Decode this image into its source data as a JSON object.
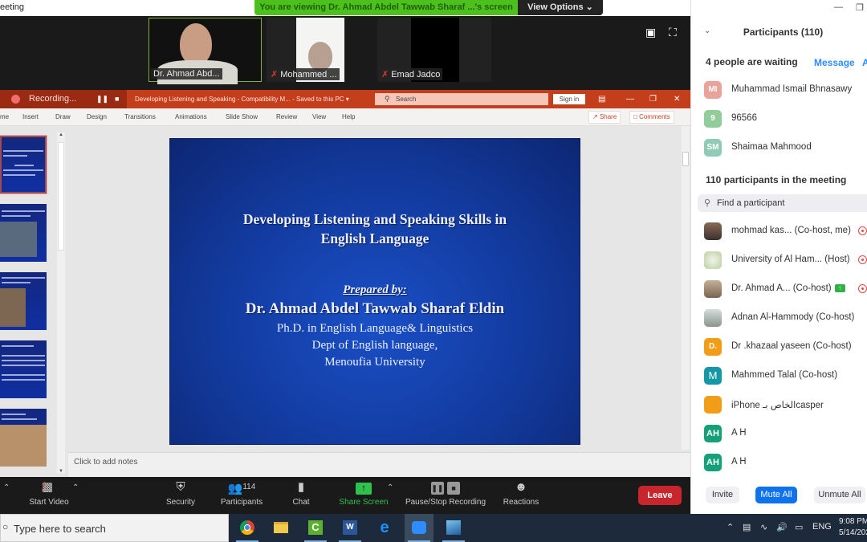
{
  "window": {
    "title": "eeting",
    "viewing_banner": "You are viewing Dr. Ahmad Abdel Tawwab Sharaf ...'s screen",
    "view_options": "View Options",
    "view_options_icon": "chevron-down-icon"
  },
  "video_tiles": [
    {
      "name": "Dr. Ahmad Abd...",
      "muted": false,
      "active_speaker": true
    },
    {
      "name": "Mohammed ...",
      "muted": true
    },
    {
      "name": "Emad Jadco",
      "muted": true
    }
  ],
  "video_controls": {
    "layout_icon": "speaker-view-icon",
    "fullscreen_icon": "fullscreen-icon"
  },
  "powerpoint": {
    "recording_label": "Recording...",
    "doc_title": "Developing Listening and Speaking  -  Compatibility M...   -  Saved to this PC  ▾",
    "search_placeholder": "Search",
    "sign_in": "Sign in",
    "ribbon_tabs": [
      "me",
      "Insert",
      "Draw",
      "Design",
      "Transitions",
      "Animations",
      "Slide Show",
      "Review",
      "View",
      "Help"
    ],
    "share": "Share",
    "comments": "Comments",
    "notes_placeholder": "Click to add notes",
    "slide": {
      "title_line1": "Developing Listening and Speaking Skills in",
      "title_line2": "English Language",
      "prepared_by": "Prepared by:",
      "author": "Dr. Ahmad Abdel Tawwab Sharaf Eldin",
      "degree": "Ph.D. in English Language& Linguistics",
      "dept": "Dept of English language,",
      "university": "Menoufia University"
    },
    "thumbnail_count": 5,
    "selected_thumbnail": 1
  },
  "toolbar": {
    "start_video": "Start Video",
    "security": "Security",
    "participants": "Participants",
    "participants_count": "114",
    "chat": "Chat",
    "share_screen": "Share Screen",
    "pause_stop_recording": "Pause/Stop Recording",
    "reactions": "Reactions",
    "leave": "Leave"
  },
  "participants_panel": {
    "title": "Participants (110)",
    "waiting_text": "4 people are waiting",
    "message_link": "Message",
    "admit_link": "A",
    "waiting": [
      {
        "initials": "MI",
        "name": "Muhammad Ismail Bhnasawy",
        "color": "#e8a49a"
      },
      {
        "initials": "9",
        "name": "96566",
        "color": "#93cc9b"
      },
      {
        "initials": "SM",
        "name": "Shaimaa Mahmood",
        "color": "#8fcbb5"
      }
    ],
    "in_meeting_text": "110 participants in the meeting",
    "find_placeholder": "Find a participant",
    "members": [
      {
        "initials": "",
        "name": "mohmad kas...  (Co-host, me)",
        "photo": true,
        "recording": true,
        "color": "#6b5040"
      },
      {
        "initials": "",
        "name": "University of Al Ham...  (Host)",
        "photo": true,
        "recording": true,
        "color": "#c9d9b0"
      },
      {
        "initials": "",
        "name": "Dr. Ahmad A...  (Co-host)",
        "photo": true,
        "recording": true,
        "sharing": true,
        "color": "#a08a70"
      },
      {
        "initials": "",
        "name": "Adnan Al-Hammody (Co-host)",
        "photo": true,
        "color": "#a0a8a0"
      },
      {
        "initials": "D.",
        "name": "Dr .khazaal yaseen (Co-host)",
        "color": "#f29d18"
      },
      {
        "initials": "M",
        "name": "Mahmmed Talal (Co-host)",
        "color": "#1597a6"
      },
      {
        "initials": "",
        "name": " iPhone الخاص بـcasper",
        "color": "#f29d18"
      },
      {
        "initials": "AH",
        "name": "A H",
        "color": "#16a07a"
      },
      {
        "initials": "AH",
        "name": "A H",
        "color": "#16a07a"
      }
    ],
    "invite": "Invite",
    "mute_all": "Mute All",
    "unmute_all": "Unmute All"
  },
  "taskbar": {
    "search_placeholder": "Type here to search",
    "apps": [
      "chrome-icon",
      "file-explorer-icon",
      "camtasia-icon",
      "word-icon",
      "edge-icon",
      "zoom-icon",
      "photos-icon"
    ],
    "language": "ENG",
    "time": "9:08 PM",
    "date": "5/14/202"
  }
}
